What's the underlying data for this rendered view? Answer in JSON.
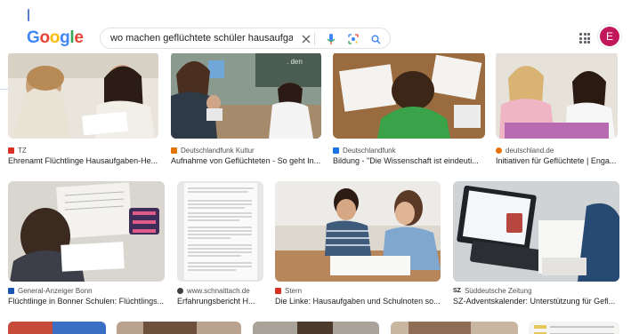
{
  "header": {
    "logo_letters": [
      {
        "ch": "G",
        "color": "#4285f4"
      },
      {
        "ch": "o",
        "color": "#ea4335"
      },
      {
        "ch": "o",
        "color": "#fbbc05"
      },
      {
        "ch": "g",
        "color": "#4285f4"
      },
      {
        "ch": "l",
        "color": "#34a853"
      },
      {
        "ch": "e",
        "color": "#ea4335"
      }
    ],
    "search_query": "wo machen geflüchtete schüler hausaufgaben",
    "avatar_letter": "E"
  },
  "results_row1": [
    {
      "source": "TZ",
      "title": "Ehrenamt Flüchtlinge Hausaufgaben-He...",
      "fav_color": "#d93025"
    },
    {
      "source": "Deutschlandfunk Kultur",
      "title": "Aufnahme von Geflüchteten - So geht In...",
      "fav_color": "#e37400"
    },
    {
      "source": "Deutschlandfunk",
      "title": "Bildung - \"Die Wissenschaft ist eindeuti...",
      "fav_color": "#1a73e8"
    },
    {
      "source": "deutschland.de",
      "title": "Initiativen für Geflüchtete | Enga...",
      "fav_color": "#e8710a"
    }
  ],
  "results_row2": [
    {
      "source": "General-Anzeiger Bonn",
      "title": "Flüchtlinge in Bonner Schulen: Flüchtlings...",
      "fav_color": "#1a56b0"
    },
    {
      "source": "www.schnaittach.de",
      "title": "Erfahrungsbericht H...",
      "fav_color": "#3c4043"
    },
    {
      "source": "Stern",
      "title": "Die Linke: Hausaufgaben und Schulnoten so...",
      "fav_color": "#d93025"
    },
    {
      "source": "Süddeutsche Zeitung",
      "title": "SZ-Adventskalender: Unterstützung für Gefl...",
      "fav_color": "#202124",
      "fav_text": "SZ"
    }
  ],
  "colors": {
    "accent": "#1a73e8",
    "avatar": "#c2185b"
  }
}
